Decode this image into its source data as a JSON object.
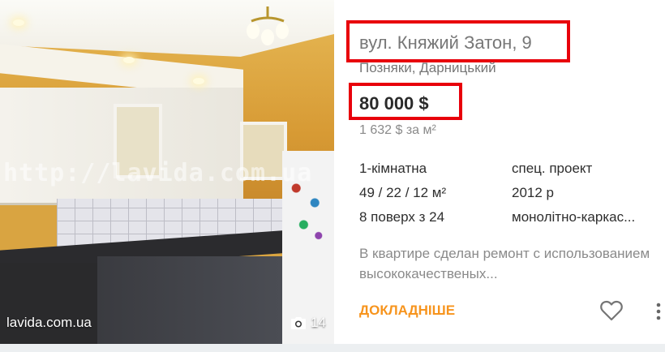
{
  "photo": {
    "watermark": "http://lavida.com.ua",
    "source": "lavida.com.ua",
    "photo_count": "14",
    "camera_icon": "camera-icon"
  },
  "listing": {
    "address": "вул. Княжий Затон, 9",
    "district": "Позняки, Дарницький",
    "price": "80 000 $",
    "price_per_m2": "1 632 $ за м²",
    "attributes": {
      "rooms": "1-кімнатна",
      "project": "спец. проект",
      "area": "49 / 22 / 12 м²",
      "year": "2012 р",
      "floor": "8 поверх з 24",
      "building_type": "монолітно-каркас..."
    },
    "description": "В квартире сделан ремонт с использованием высококачественых...",
    "more_link": "ДОКЛАДНІШЕ",
    "favorite_icon": "heart-icon",
    "menu_icon": "more-vertical-icon"
  },
  "colors": {
    "highlight": "#e8000b",
    "accent": "#f7941d"
  }
}
